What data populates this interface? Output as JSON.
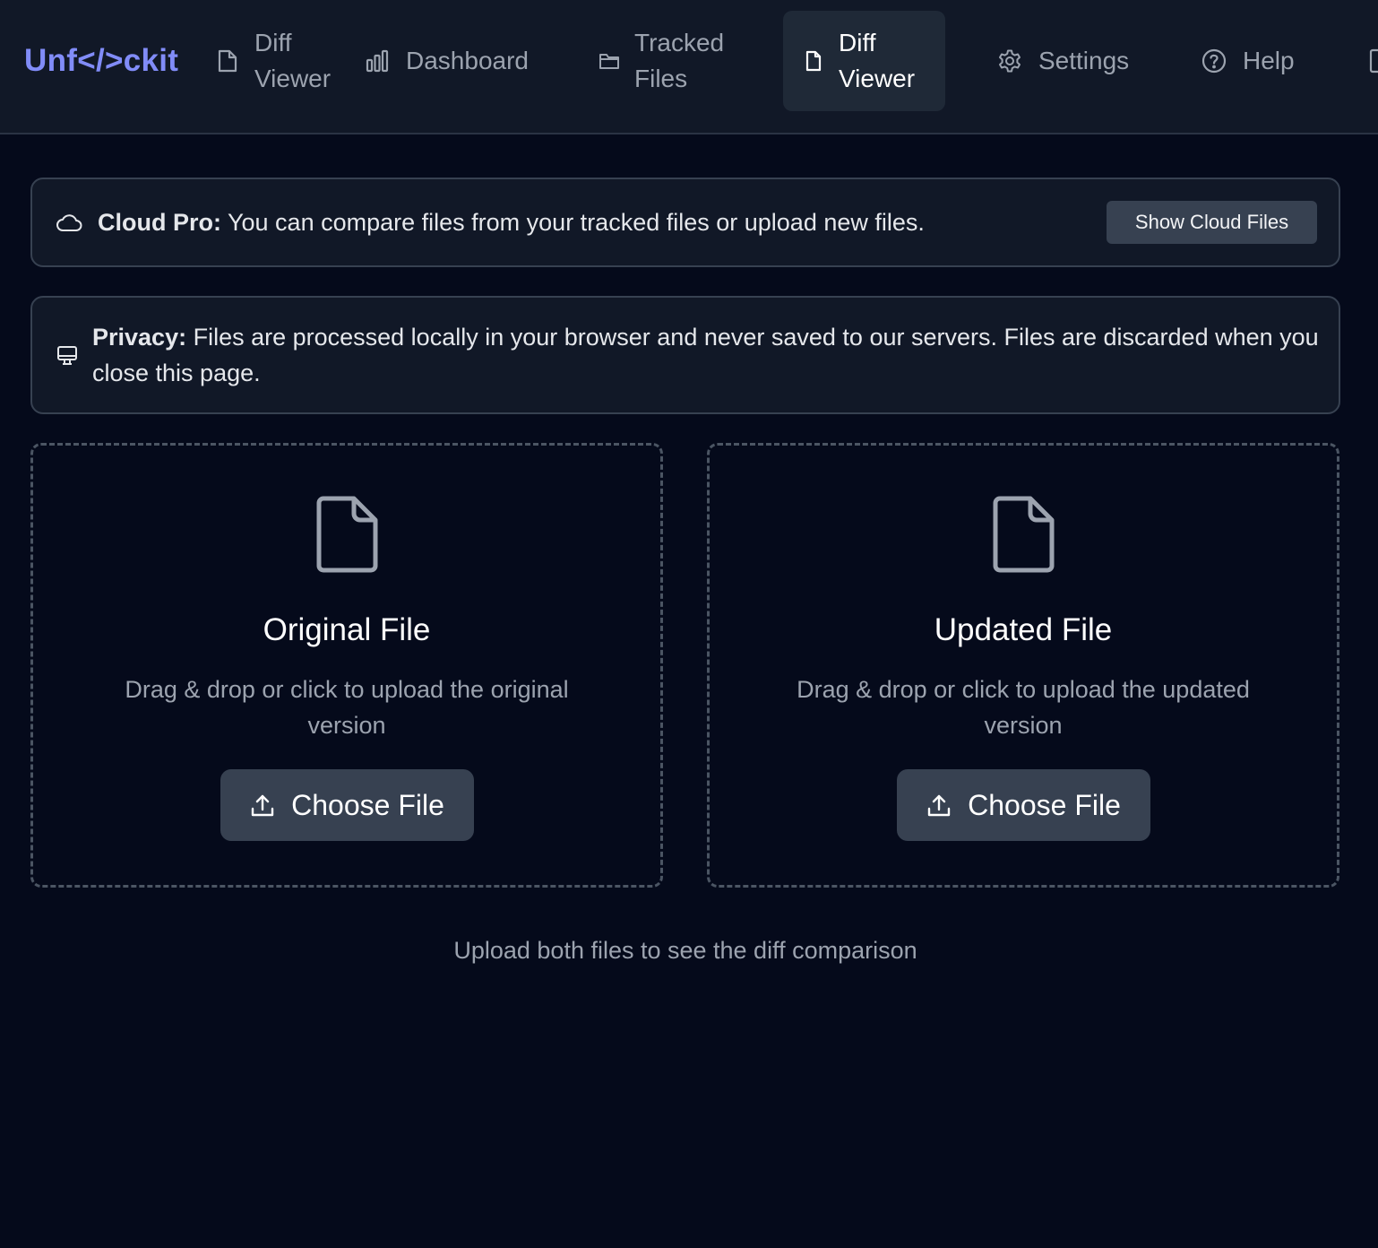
{
  "app": {
    "logo": "Unf</>ckit",
    "accent_color": "#818cf8"
  },
  "nav": {
    "items": [
      {
        "label": "Diff Viewer",
        "icon": "file-icon",
        "active": false
      },
      {
        "label": "Dashboard",
        "icon": "bar-chart-icon",
        "active": false
      },
      {
        "label": "Tracked Files",
        "icon": "folder-icon",
        "active": false
      },
      {
        "label": "Diff Viewer",
        "icon": "file-icon",
        "active": true
      },
      {
        "label": "Settings",
        "icon": "gear-icon",
        "active": false
      },
      {
        "label": "Help",
        "icon": "help-circle-icon",
        "active": false
      }
    ]
  },
  "cloud_banner": {
    "icon": "cloud-icon",
    "title": "Cloud Pro:",
    "text": " You can compare files from your tracked files or upload new files.",
    "button_label": "Show Cloud Files"
  },
  "privacy_banner": {
    "icon": "monitor-icon",
    "title": "Privacy:",
    "text": " Files are processed locally in your browser and never saved to our servers. Files are discarded when you close this page."
  },
  "uploads": {
    "original": {
      "icon": "file-icon",
      "title": "Original File",
      "description": "Drag & drop or click to upload the original version",
      "button_label": "Choose File",
      "button_icon": "upload-icon"
    },
    "updated": {
      "icon": "file-icon",
      "title": "Updated File",
      "description": "Drag & drop or click to upload the updated version",
      "button_label": "Choose File",
      "button_icon": "upload-icon"
    }
  },
  "footer_hint": "Upload both files to see the diff comparison"
}
